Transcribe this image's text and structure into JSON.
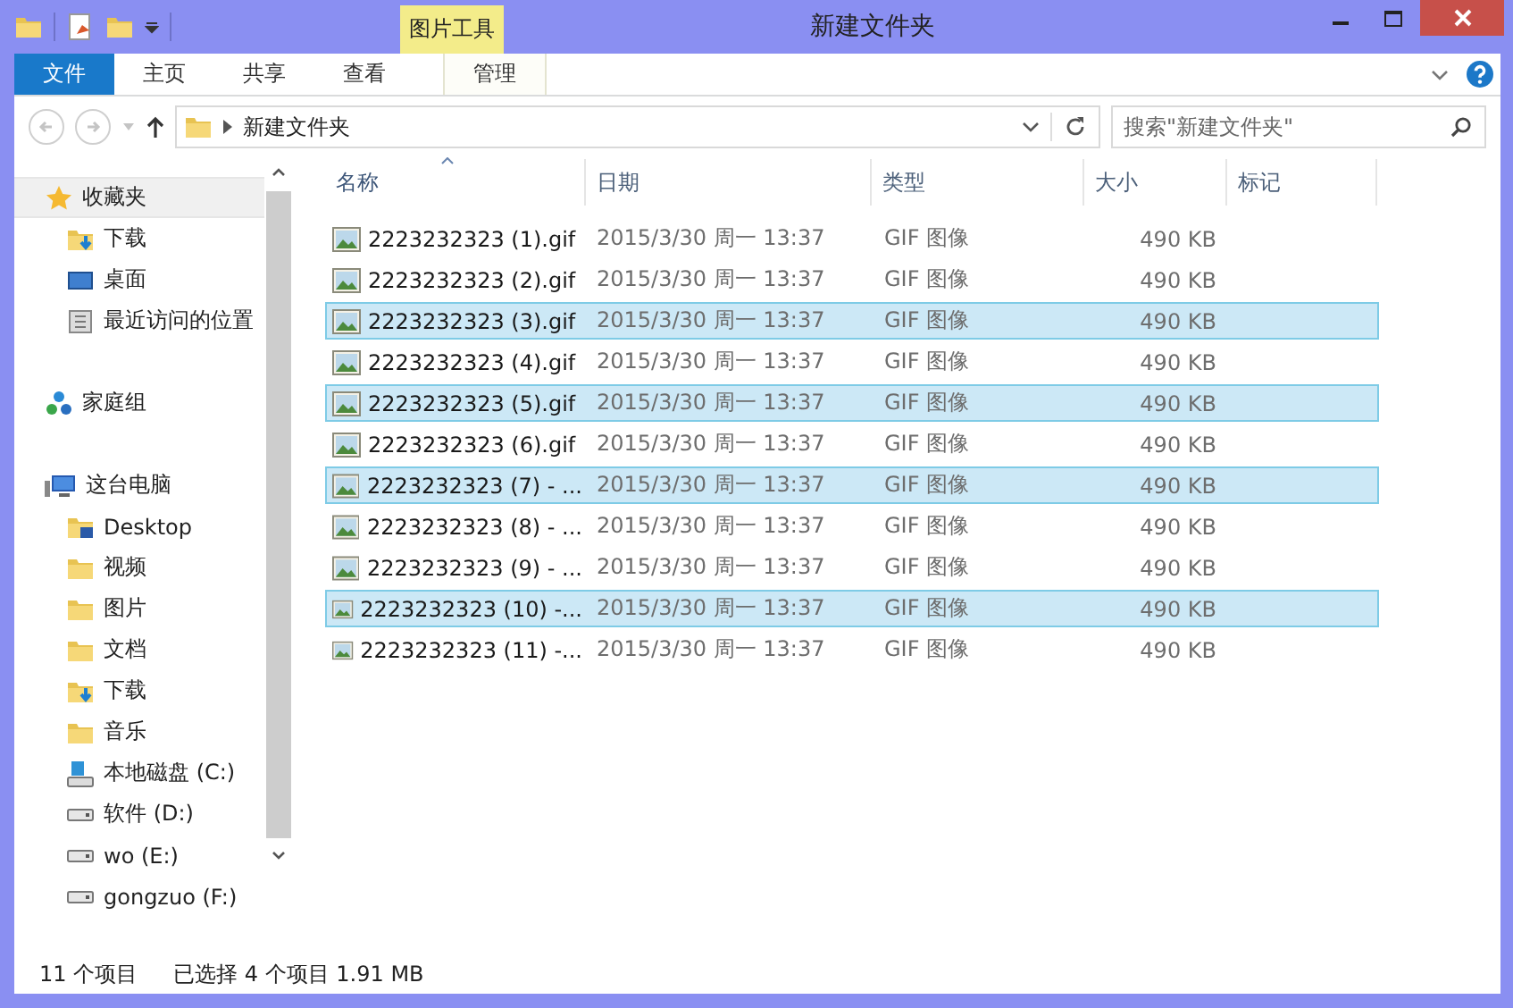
{
  "window": {
    "title": "新建文件夹"
  },
  "contextual_group": {
    "label": "图片工具"
  },
  "ribbon_tabs": [
    {
      "label": "文件",
      "kind": "file"
    },
    {
      "label": "主页",
      "kind": "normal"
    },
    {
      "label": "共享",
      "kind": "normal"
    },
    {
      "label": "查看",
      "kind": "normal"
    },
    {
      "label": "管理",
      "kind": "contextual"
    }
  ],
  "address": {
    "path": "新建文件夹"
  },
  "search": {
    "placeholder": "搜索\"新建文件夹\""
  },
  "sidebar": {
    "items": [
      {
        "label": "收藏夹",
        "kind": "favorites",
        "selected": true,
        "children": [
          {
            "label": "下载",
            "kind": "download",
            "selected": false
          },
          {
            "label": "桌面",
            "kind": "desktop",
            "selected": false
          },
          {
            "label": "最近访问的位置",
            "kind": "recent",
            "selected": false
          }
        ]
      },
      {
        "label": "家庭组",
        "kind": "homegroup",
        "selected": false
      },
      {
        "label": "这台电脑",
        "kind": "pc",
        "selected": false,
        "children": [
          {
            "label": "Desktop",
            "kind": "desktop-folder",
            "selected": false
          },
          {
            "label": "视频",
            "kind": "folder",
            "selected": false
          },
          {
            "label": "图片",
            "kind": "folder",
            "selected": false
          },
          {
            "label": "文档",
            "kind": "folder",
            "selected": false
          },
          {
            "label": "下载",
            "kind": "download",
            "selected": false
          },
          {
            "label": "音乐",
            "kind": "folder",
            "selected": false
          },
          {
            "label": "本地磁盘 (C:)",
            "kind": "system-drive",
            "selected": false
          },
          {
            "label": "软件 (D:)",
            "kind": "drive",
            "selected": false
          },
          {
            "label": "wo (E:)",
            "kind": "drive",
            "selected": false
          },
          {
            "label": "gongzuo (F:)",
            "kind": "drive",
            "selected": false
          }
        ]
      }
    ]
  },
  "table": {
    "columns": [
      {
        "label": "名称",
        "sorted": true
      },
      {
        "label": "日期",
        "sorted": false
      },
      {
        "label": "类型",
        "sorted": false
      },
      {
        "label": "大小",
        "sorted": false
      },
      {
        "label": "标记",
        "sorted": false
      }
    ],
    "rows": [
      {
        "name": "2223232323 (1).gif",
        "date": "2015/3/30 周一 13:37",
        "type": "GIF 图像",
        "size": "490 KB",
        "selected": false
      },
      {
        "name": "2223232323 (2).gif",
        "date": "2015/3/30 周一 13:37",
        "type": "GIF 图像",
        "size": "490 KB",
        "selected": false
      },
      {
        "name": "2223232323 (3).gif",
        "date": "2015/3/30 周一 13:37",
        "type": "GIF 图像",
        "size": "490 KB",
        "selected": true
      },
      {
        "name": "2223232323 (4).gif",
        "date": "2015/3/30 周一 13:37",
        "type": "GIF 图像",
        "size": "490 KB",
        "selected": false
      },
      {
        "name": "2223232323 (5).gif",
        "date": "2015/3/30 周一 13:37",
        "type": "GIF 图像",
        "size": "490 KB",
        "selected": true
      },
      {
        "name": "2223232323 (6).gif",
        "date": "2015/3/30 周一 13:37",
        "type": "GIF 图像",
        "size": "490 KB",
        "selected": false
      },
      {
        "name": "2223232323 (7) - ...",
        "date": "2015/3/30 周一 13:37",
        "type": "GIF 图像",
        "size": "490 KB",
        "selected": true
      },
      {
        "name": "2223232323 (8) - ...",
        "date": "2015/3/30 周一 13:37",
        "type": "GIF 图像",
        "size": "490 KB",
        "selected": false
      },
      {
        "name": "2223232323 (9) - ...",
        "date": "2015/3/30 周一 13:37",
        "type": "GIF 图像",
        "size": "490 KB",
        "selected": false
      },
      {
        "name": "2223232323 (10) -...",
        "date": "2015/3/30 周一 13:37",
        "type": "GIF 图像",
        "size": "490 KB",
        "selected": true
      },
      {
        "name": "2223232323 (11) -...",
        "date": "2015/3/30 周一 13:37",
        "type": "GIF 图像",
        "size": "490 KB",
        "selected": false
      }
    ]
  },
  "status_bar": {
    "item_count": "11 个项目",
    "selection": "已选择 4 个项目 1.91 MB"
  }
}
